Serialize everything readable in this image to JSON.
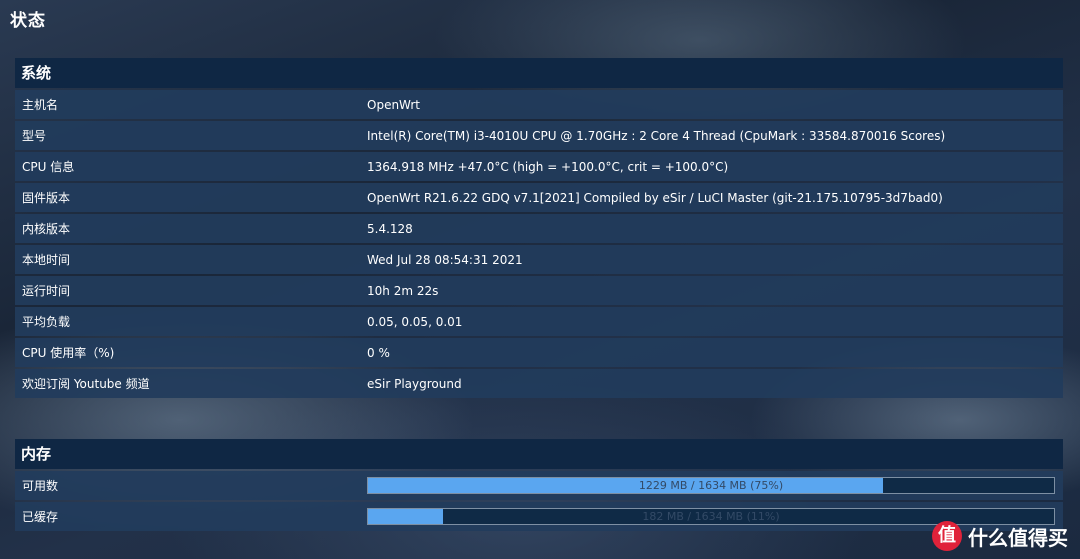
{
  "page": {
    "title": "状态"
  },
  "system": {
    "title": "系统",
    "rows": [
      {
        "label": "主机名",
        "value": "OpenWrt"
      },
      {
        "label": "型号",
        "value": "Intel(R) Core(TM) i3-4010U CPU @ 1.70GHz : 2 Core 4 Thread (CpuMark : 33584.870016 Scores)"
      },
      {
        "label": "CPU 信息",
        "value": "1364.918 MHz +47.0°C (high = +100.0°C, crit = +100.0°C)"
      },
      {
        "label": "固件版本",
        "value": "OpenWrt R21.6.22 GDQ v7.1[2021] Compiled by eSir / LuCI Master (git-21.175.10795-3d7bad0)"
      },
      {
        "label": "内核版本",
        "value": "5.4.128"
      },
      {
        "label": "本地时间",
        "value": "Wed Jul 28 08:54:31 2021"
      },
      {
        "label": "运行时间",
        "value": "10h 2m 22s"
      },
      {
        "label": "平均负载",
        "value": "0.05, 0.05, 0.01"
      },
      {
        "label": "CPU 使用率（%)",
        "value": "0 %"
      },
      {
        "label": "欢迎订阅 Youtube 频道",
        "value": "eSir Playground"
      }
    ]
  },
  "memory": {
    "title": "内存",
    "rows": [
      {
        "label": "可用数",
        "text": "1229 MB / 1634 MB (75%)",
        "percent": 75
      },
      {
        "label": "已缓存",
        "text": "182 MB / 1634 MB (11%)",
        "percent": 11
      }
    ]
  },
  "watermark": {
    "badge": "值",
    "text": "什么值得买"
  },
  "colors": {
    "header": "#0f2744",
    "row": "#223c5c",
    "bar_fill": "#5aa6f0"
  }
}
